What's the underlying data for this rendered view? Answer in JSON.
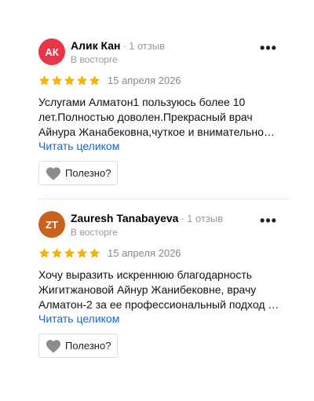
{
  "colors": {
    "rating_star": "#f5b400",
    "link": "#1966c8",
    "heart": "#8c8c8c"
  },
  "reviews": [
    {
      "initials": "АК",
      "avatar_color": "#ea3447",
      "author": "Алик Кан",
      "separator": "·",
      "reviews_count": "1 отзыв",
      "status": "В восторге",
      "more_label": "•••",
      "rating": 5,
      "date": "15 апреля 2026",
      "text_lines": [
        "Услугами Алматон1 пользуюсь более 10",
        "лет.Полностью доволен.Прекрасный врач",
        "Айнура Жанабековна,чуткое и внимательно…"
      ],
      "read_more": "Читать целиком",
      "helpful_label": "Полезно?"
    },
    {
      "initials": "ZT",
      "avatar_color": "#c9621d",
      "author": "Zauresh Tanabayeva",
      "separator": "·",
      "reviews_count": "1 отзыв",
      "status": "В восторге",
      "more_label": "•••",
      "rating": 5,
      "date": "15 апреля 2026",
      "text_lines": [
        "Хочу выразить искреннюю благодарность",
        "Жигитжановой Айнур Жанибековне, врачу",
        "Алматон-2 за ее профессиональный подход …"
      ],
      "read_more": "Читать целиком",
      "helpful_label": "Полезно?"
    }
  ]
}
